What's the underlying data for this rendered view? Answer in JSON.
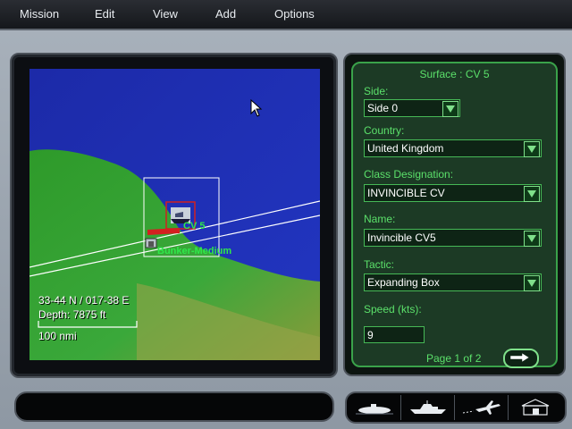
{
  "menu": {
    "items": [
      "Mission",
      "Edit",
      "View",
      "Add",
      "Options"
    ]
  },
  "map": {
    "coords": "33-44 N / 017-38 E",
    "depth": "Depth: 7875 ft",
    "scale_label": "100 nmi",
    "unit_labels": [
      "CV 5",
      "Bunker-Medium"
    ]
  },
  "panel": {
    "title": "Surface : CV 5",
    "side_label": "Side:",
    "side_value": "Side 0",
    "country_label": "Country:",
    "country_value": "United Kingdom",
    "class_label": "Class Designation:",
    "class_value": "INVINCIBLE CV",
    "name_label": "Name:",
    "name_value": "Invincible CV5",
    "tactic_label": "Tactic:",
    "tactic_value": "Expanding Box",
    "speed_label": "Speed (kts):",
    "speed_value": "9",
    "page_label": "Page 1 of 2"
  },
  "bottom": {
    "unit_buttons": [
      "submarine-icon",
      "ship-icon",
      "aircraft-icon",
      "building-icon"
    ]
  },
  "colors": {
    "panel_green": "#5be06a",
    "ocean": "#1f2fb4",
    "land": "#2a8c2e"
  }
}
